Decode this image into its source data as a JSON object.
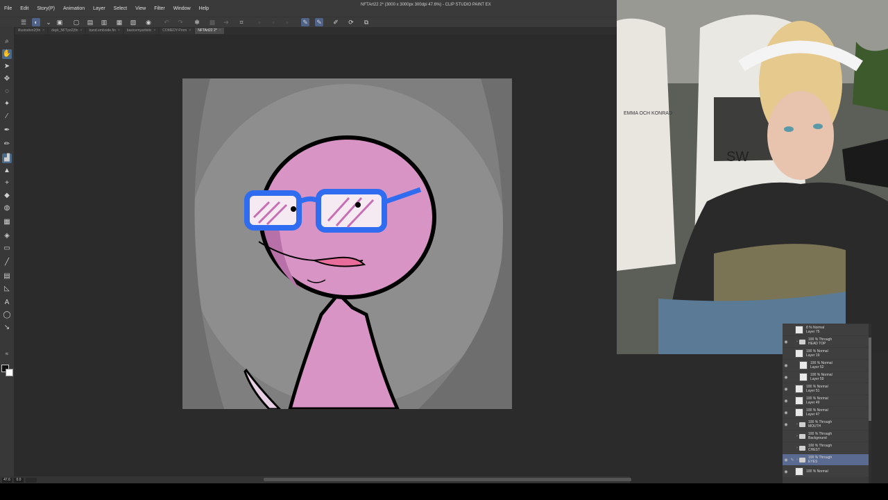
{
  "app": {
    "window_title": "NFTArt22 2* (3000 x 3000px 300dpi 47.6%) - CLIP STUDIO PAINT EX"
  },
  "menu": [
    "File",
    "Edit",
    "Story(P)",
    "Animation",
    "Layer",
    "Select",
    "View",
    "Filter",
    "Window",
    "Help"
  ],
  "document_tabs": [
    {
      "label": "illustration2(fin",
      "active": false
    },
    {
      "label": "dayk_NFTpo2(fin",
      "active": false
    },
    {
      "label": "band.emboide.fin",
      "active": false
    },
    {
      "label": "basicemyartistic",
      "active": false
    },
    {
      "label": "COMEDY-Prom",
      "active": false
    },
    {
      "label": "NFTArt22 2*",
      "active": true
    }
  ],
  "status": {
    "zoom": "47.6",
    "angle": "0.0"
  },
  "layers": [
    {
      "mode": "8 % Normal",
      "name": "Layer 75",
      "type": "raster",
      "visible": false,
      "indent": 0
    },
    {
      "mode": "100 % Through",
      "name": "HEAD TOP",
      "type": "folder",
      "visible": true,
      "indent": 1
    },
    {
      "mode": "100 % Normal",
      "name": "Layer 19",
      "type": "raster",
      "visible": false,
      "indent": 0
    },
    {
      "mode": "100 % Normal",
      "name": "Layer 52",
      "type": "raster",
      "visible": true,
      "indent": 2
    },
    {
      "mode": "100 % Normal",
      "name": "Layer 59",
      "type": "raster",
      "visible": true,
      "indent": 2
    },
    {
      "mode": "100 % Normal",
      "name": "Layer 51",
      "type": "raster",
      "visible": true,
      "indent": 0
    },
    {
      "mode": "100 % Normal",
      "name": "Layer 49",
      "type": "raster",
      "visible": true,
      "indent": 0
    },
    {
      "mode": "100 % Normal",
      "name": "Layer 47",
      "type": "raster",
      "visible": true,
      "indent": 0
    },
    {
      "mode": "100 % Through",
      "name": "MOUTH",
      "type": "folder",
      "visible": true,
      "indent": 1
    },
    {
      "mode": "100 % Through",
      "name": "Background",
      "type": "folder",
      "visible": false,
      "indent": 1
    },
    {
      "mode": "100 % Through",
      "name": "CHEST",
      "type": "folder",
      "visible": false,
      "indent": 1
    },
    {
      "mode": "100 % Through",
      "name": "EYES",
      "type": "folder",
      "visible": true,
      "indent": 1,
      "selected": true
    },
    {
      "mode": "100 % Normal",
      "name": "",
      "type": "raster",
      "visible": true,
      "indent": 0
    }
  ],
  "webcam": {
    "chair_brand": "EMMA OCH KONRAD",
    "chair_text": "SW"
  },
  "colors": {
    "accent": "#4f6388",
    "canvas_bg": "#7a7a7a",
    "character_pink": "#d794c4",
    "glasses_blue": "#2f6cf0"
  }
}
